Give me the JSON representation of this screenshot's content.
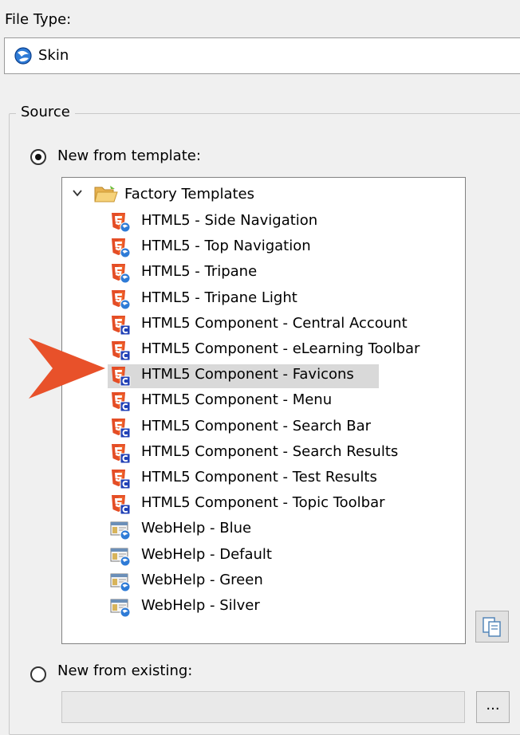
{
  "file_type": {
    "label": "File Type:",
    "value": "Skin",
    "icon": "skin-globe-icon"
  },
  "source": {
    "legend": "Source",
    "new_from_template_label": "New from template:",
    "new_from_template_selected": true,
    "new_from_existing_label": "New from existing:",
    "new_from_existing_selected": false,
    "existing_path_value": "",
    "browse_label": "..."
  },
  "tree": {
    "root_label": "Factory Templates",
    "root_expanded": true,
    "items": [
      {
        "label": "HTML5 - Side Navigation",
        "icon": "html5-skin-icon"
      },
      {
        "label": "HTML5 - Top Navigation",
        "icon": "html5-skin-icon"
      },
      {
        "label": "HTML5 - Tripane",
        "icon": "html5-skin-icon"
      },
      {
        "label": "HTML5 - Tripane Light",
        "icon": "html5-skin-icon"
      },
      {
        "label": "HTML5 Component - Central Account",
        "icon": "html5-component-icon"
      },
      {
        "label": "HTML5 Component - eLearning Toolbar",
        "icon": "html5-component-icon"
      },
      {
        "label": "HTML5 Component - Favicons",
        "icon": "html5-component-icon",
        "selected": true
      },
      {
        "label": "HTML5 Component - Menu",
        "icon": "html5-component-icon"
      },
      {
        "label": "HTML5 Component - Search Bar",
        "icon": "html5-component-icon"
      },
      {
        "label": "HTML5 Component - Search Results",
        "icon": "html5-component-icon"
      },
      {
        "label": "HTML5 Component - Test Results",
        "icon": "html5-component-icon"
      },
      {
        "label": "HTML5 Component - Topic Toolbar",
        "icon": "html5-component-icon"
      },
      {
        "label": "WebHelp - Blue",
        "icon": "webhelp-skin-icon"
      },
      {
        "label": "WebHelp - Default",
        "icon": "webhelp-skin-icon"
      },
      {
        "label": "WebHelp - Green",
        "icon": "webhelp-skin-icon"
      },
      {
        "label": "WebHelp - Silver",
        "icon": "webhelp-skin-icon"
      }
    ]
  },
  "colors": {
    "callout_arrow": "#e8512a",
    "html5_red": "#e44d26",
    "component_blue": "#1f3fb5",
    "selection": "#d9d9d9"
  }
}
